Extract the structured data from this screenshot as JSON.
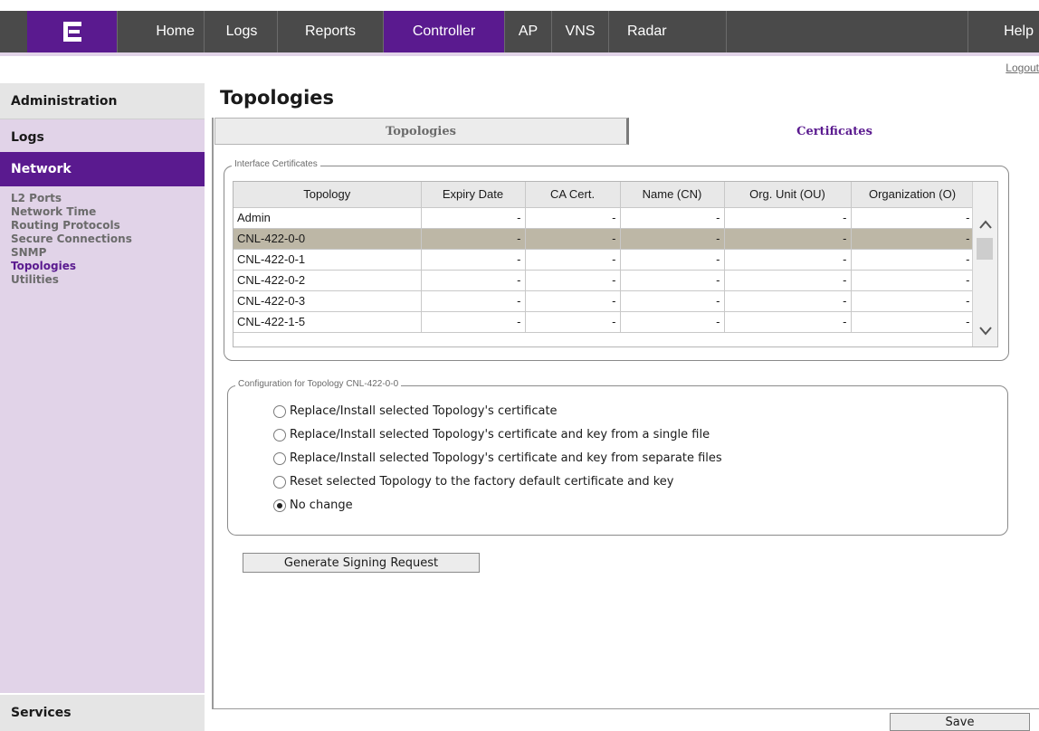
{
  "nav": {
    "logo_alt": "Extreme logo",
    "home": "Home",
    "logs": "Logs",
    "reports": "Reports",
    "controller": "Controller",
    "ap": "AP",
    "vns": "VNS",
    "radar": "Radar",
    "help": "Help"
  },
  "logout": "Logout",
  "sidebar": {
    "administration": "Administration",
    "logs": "Logs",
    "network": "Network",
    "items": [
      {
        "label": "L2 Ports"
      },
      {
        "label": "Network Time"
      },
      {
        "label": "Routing Protocols"
      },
      {
        "label": "Secure Connections"
      },
      {
        "label": "SNMP"
      },
      {
        "label": "Topologies",
        "active": true
      },
      {
        "label": "Utilities"
      }
    ],
    "services": "Services"
  },
  "page": {
    "title": "Topologies",
    "tabs": {
      "topologies": "Topologies",
      "certificates": "Certificates"
    }
  },
  "interface_certificates": {
    "legend": "Interface Certificates",
    "columns": [
      "Topology",
      "Expiry Date",
      "CA Cert.",
      "Name (CN)",
      "Org. Unit (OU)",
      "Organization (O)"
    ],
    "rows": [
      {
        "topology": "Admin",
        "expiry": "-",
        "ca": "-",
        "cn": "-",
        "ou": "-",
        "org": "-"
      },
      {
        "topology": "CNL-422-0-0",
        "expiry": "-",
        "ca": "-",
        "cn": "-",
        "ou": "-",
        "org": "-",
        "selected": true
      },
      {
        "topology": "CNL-422-0-1",
        "expiry": "-",
        "ca": "-",
        "cn": "-",
        "ou": "-",
        "org": "-"
      },
      {
        "topology": "CNL-422-0-2",
        "expiry": "-",
        "ca": "-",
        "cn": "-",
        "ou": "-",
        "org": "-"
      },
      {
        "topology": "CNL-422-0-3",
        "expiry": "-",
        "ca": "-",
        "cn": "-",
        "ou": "-",
        "org": "-"
      },
      {
        "topology": "CNL-422-1-5",
        "expiry": "-",
        "ca": "-",
        "cn": "-",
        "ou": "-",
        "org": "-"
      }
    ]
  },
  "config": {
    "legend": "Configuration for Topology CNL-422-0-0",
    "options": [
      {
        "label": "Replace/Install selected Topology's certificate",
        "checked": false
      },
      {
        "label": "Replace/Install selected Topology's certificate and key from a single file",
        "checked": false
      },
      {
        "label": "Replace/Install selected Topology's certificate and key from separate files",
        "checked": false
      },
      {
        "label": "Reset selected Topology to the factory default certificate and key",
        "checked": false
      },
      {
        "label": "No change",
        "checked": true
      }
    ]
  },
  "buttons": {
    "generate": "Generate Signing Request",
    "save": "Save"
  },
  "colors": {
    "brand_purple": "#5a1a8f",
    "nav_gray": "#4a4a4a",
    "sidebar_lavender": "#e1d3e8",
    "selected_row": "#bdb7a6"
  }
}
